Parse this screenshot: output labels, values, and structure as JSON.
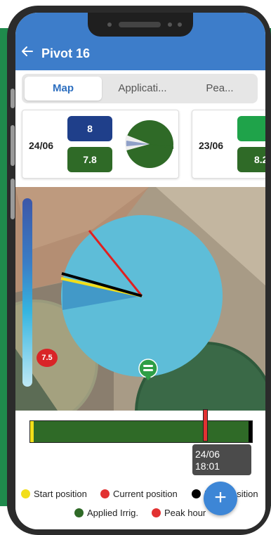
{
  "app": {
    "title": "Pivot 16"
  },
  "tabs": [
    {
      "label": "Map",
      "active": true
    },
    {
      "label": "Applicati...",
      "active": false
    },
    {
      "label": "Pea...",
      "active": false
    }
  ],
  "cards": [
    {
      "date": "24/06",
      "value_top": "8",
      "value_bottom": "7.8"
    },
    {
      "date": "23/06",
      "value_top": "",
      "value_bottom": "8.2"
    }
  ],
  "map": {
    "marker_value": "7.5"
  },
  "timeline": {
    "tooltip_date": "24/06",
    "tooltip_time": "18:01"
  },
  "legend": {
    "start": "Start position",
    "current": "Current position",
    "final": "Final position",
    "applied": "Applied Irrig.",
    "peak": "Peak hour"
  },
  "colors": {
    "appbar": "#3d7dca",
    "dark_blue": "#1f3f8a",
    "dark_green": "#2f6a27",
    "bright_green": "#1fa34a",
    "yellow": "#f2de1a",
    "red": "#e23232",
    "black": "#000000"
  },
  "icons": {
    "back": "arrow-left-icon",
    "fab": "plus-icon",
    "pivot": "pivot-marker-icon"
  }
}
